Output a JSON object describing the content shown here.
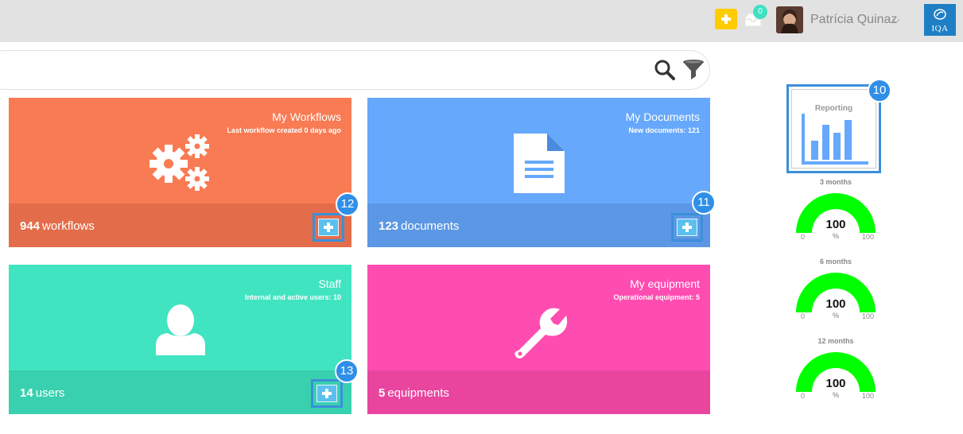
{
  "header": {
    "notification_count": "0",
    "user_name": "Patrícia Quinaz",
    "logo_text": "IQA"
  },
  "cards": [
    {
      "title": "My Workflows",
      "subtitle": "Last workflow created 0 days ago",
      "count": "944",
      "unit": "workflows",
      "color": "#f87b53",
      "footer_color": "#e36d4a",
      "badge": "12",
      "icon": "gears-icon"
    },
    {
      "title": "My Documents",
      "subtitle": "New documents: 121",
      "count": "123",
      "unit": "documents",
      "color": "#66a8fc",
      "footer_color": "#5b97e4",
      "badge": "11",
      "icon": "document-icon"
    },
    {
      "title": "Staff",
      "subtitle": "Internal and active users: 10",
      "count": "14",
      "unit": "users",
      "color": "#41e4c1",
      "footer_color": "#39d0af",
      "badge": "13",
      "icon": "user-icon"
    },
    {
      "title": "My equipment",
      "subtitle": "Operational equipment: 5",
      "count": "5",
      "unit": "equipments",
      "color": "#ff4cb1",
      "footer_color": "#e9459f",
      "badge": "",
      "icon": "wrench-icon"
    }
  ],
  "reporting": {
    "label": "Reporting",
    "badge": "10"
  },
  "gauges": [
    {
      "period": "3 months",
      "value": "100",
      "unit": "%",
      "min": "0",
      "max": "100",
      "level": 1.0
    },
    {
      "period": "6 months",
      "value": "100",
      "unit": "%",
      "min": "0",
      "max": "100",
      "level": 1.0
    },
    {
      "period": "12 months",
      "value": "100",
      "unit": "%",
      "min": "0",
      "max": "100",
      "level": 1.0
    }
  ],
  "colors": {
    "accent": "#3b8fd9",
    "gauge_fill": "#00ff00",
    "topbar": "#e2e2e2"
  }
}
